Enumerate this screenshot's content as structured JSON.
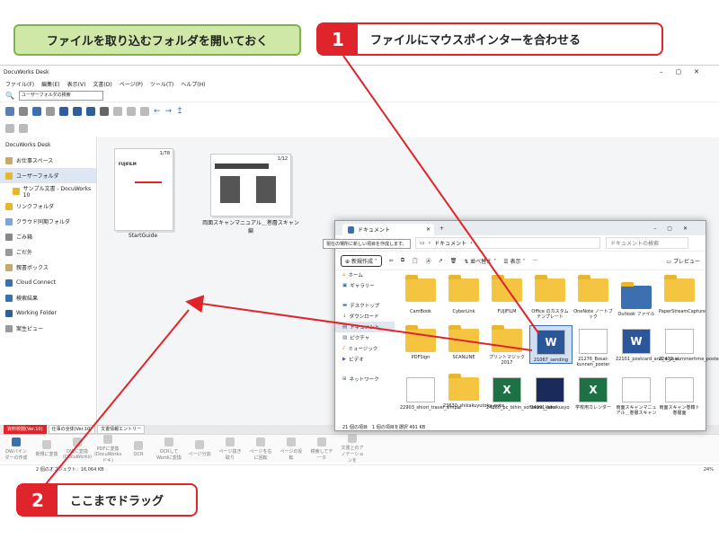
{
  "callouts": {
    "green": "ファイルを取り込むフォルダを開いておく",
    "step1": {
      "num": "1",
      "text": "ファイルにマウスポインターを合わせる"
    },
    "step2": {
      "num": "2",
      "text": "ここまでドラッグ"
    }
  },
  "docuworks": {
    "title": "DocuWorks Desk",
    "menus": [
      "ファイル(F)",
      "編集(E)",
      "表示(V)",
      "文書(D)",
      "ページ(P)",
      "ツール(T)",
      "ヘルプ(H)"
    ],
    "search_label": "ユーザーフォルダの検索",
    "tree": [
      {
        "label": "DocuWorks Desk",
        "selected": false
      },
      {
        "label": "お仕事スペース",
        "selected": false
      },
      {
        "label": "ユーザーフォルダ",
        "selected": true
      },
      {
        "label": "サンプル文書 - DocuWorks 10",
        "selected": false
      },
      {
        "label": "リンクフォルダ",
        "selected": false
      },
      {
        "label": "クラウド同期フォルダ",
        "selected": false
      },
      {
        "label": "ごみ箱",
        "selected": false
      },
      {
        "label": "ごだ外",
        "selected": false
      },
      {
        "label": "親書ボックス",
        "selected": false
      },
      {
        "label": "Cloud Connect",
        "selected": false
      },
      {
        "label": "検索結果",
        "selected": false
      },
      {
        "label": "Working Folder",
        "selected": false
      },
      {
        "label": "案生ピュー",
        "selected": false
      }
    ],
    "docs": [
      {
        "name": "StartGuide",
        "pages": "1/78"
      },
      {
        "name": "両面スキャンマニュアル＿巻層スキャン編",
        "pages": "1/12"
      }
    ],
    "tabs": [
      "資料校閲(Ver.10)",
      "仕事の全体(Ver.10)",
      "文書情報エントリー"
    ],
    "ribbon": [
      "DWバインダーの作成",
      "新規に変換",
      "DWに変換(DocuWorks)",
      "PDFに変換(DocuWorks ドキ)",
      "OCR",
      "OCRしてWordに変換",
      "ページ分割",
      "ページ抜き取り",
      "ページを右に回転",
      "ページの反転",
      "検索してデータ",
      "文書上のアノテーションを"
    ],
    "status": "2 個のオブジェクト：16,064 KB",
    "zoom": "24%"
  },
  "explorer": {
    "tab_title": "ドキュメント",
    "tooltip": "現在の場所に新しい項目を作成します。",
    "breadcrumb": "ドキュメント",
    "search_placeholder": "ドキュメントの検索",
    "new_button": "新規作成",
    "sort_button": "並べ替え",
    "view_button": "表示",
    "preview_button": "プレビュー",
    "nav": [
      {
        "label": "ホーム",
        "selected": false
      },
      {
        "label": "ギャラリー",
        "selected": false
      },
      {
        "label": "デスクトップ",
        "selected": false
      },
      {
        "label": "ダウンロード",
        "selected": false
      },
      {
        "label": "ドキュメント",
        "selected": true
      },
      {
        "label": "ピクチャ",
        "selected": false
      },
      {
        "label": "ミュージック",
        "selected": false
      },
      {
        "label": "ビデオ",
        "selected": false
      },
      {
        "label": "ネットワーク",
        "selected": false
      }
    ],
    "files": [
      {
        "name": "",
        "kind": "folder"
      },
      {
        "name": "",
        "kind": "folder"
      },
      {
        "name": "",
        "kind": "folder"
      },
      {
        "name": "",
        "kind": "folder"
      },
      {
        "name": "",
        "kind": "folder"
      },
      {
        "name": "",
        "kind": "folder"
      },
      {
        "name": "CamBook",
        "kind": "folder"
      },
      {
        "name": "CyberLink",
        "kind": "folder"
      },
      {
        "name": "FUJIFILM",
        "kind": "folder"
      },
      {
        "name": "Office のカスタム テンプレート",
        "kind": "folder"
      },
      {
        "name": "OneNote ノートブック",
        "kind": "folder"
      },
      {
        "name": "Outlook ファイル",
        "kind": "folder"
      },
      {
        "name": "PaperStreamCapture",
        "kind": "folder"
      },
      {
        "name": "PDFSign",
        "kind": "folder"
      },
      {
        "name": "SCANLINE",
        "kind": "folder"
      },
      {
        "name": "プリントマジック 2017",
        "kind": "folder"
      },
      {
        "name": "21067_sending",
        "kind": "word"
      },
      {
        "name": "21276_Bosai-kunnen_poster",
        "kind": "thumb"
      },
      {
        "name": "22101_postcard_and_a_jisai",
        "kind": "word"
      },
      {
        "name": "22402_summertime_poster",
        "kind": "thumb"
      },
      {
        "name": "22903_shiori_travel_simple",
        "kind": "thumb"
      },
      {
        "name": "23630_shikakuyutoku_note",
        "kind": "folder"
      },
      {
        "name": "24860_pc_bihin_software_kanri",
        "kind": "excel"
      },
      {
        "name": "24991_kikakusyo",
        "kind": "thumb"
      },
      {
        "name": "学校用カレンダー",
        "kind": "excel"
      },
      {
        "name": "両面スキャンマニュアル＿巻層スキャン",
        "kind": "thumb"
      },
      {
        "name": "両面スキャン巻籍ト巻層面",
        "kind": "thumb"
      }
    ],
    "footer": "21 個の項目　1 個の項目を選択 491 KB"
  }
}
